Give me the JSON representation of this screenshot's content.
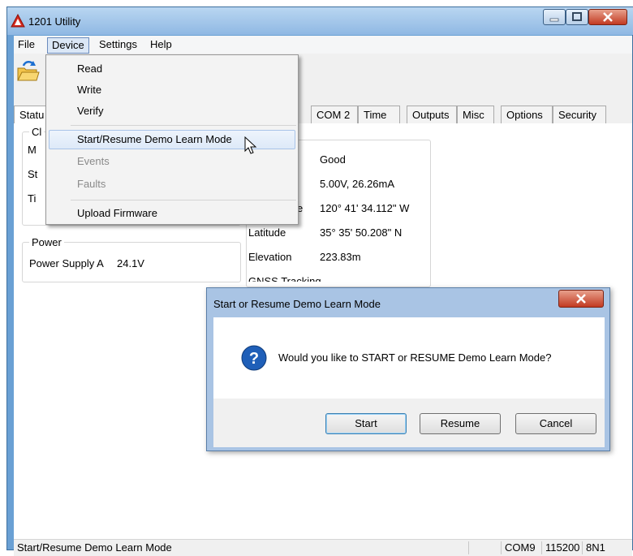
{
  "window": {
    "title": "1201 Utility"
  },
  "menubar": {
    "file": "File",
    "device": "Device",
    "settings": "Settings",
    "help": "Help"
  },
  "tabs": [
    "Statu",
    "COM 2",
    "Time",
    "Outputs",
    "Misc",
    "Options",
    "Security"
  ],
  "clock_group": {
    "label": "Cl",
    "rows": [
      "M",
      "St",
      "Ti"
    ]
  },
  "power_group": {
    "label": "Power",
    "supply_label": "Power Supply A",
    "supply_value": "24.1V"
  },
  "gnss_panel": {
    "rows": [
      {
        "label": "",
        "value": "Good"
      },
      {
        "label": "",
        "value": "5.00V, 26.26mA"
      },
      {
        "label": "e",
        "value": "120° 41' 34.112\" W"
      },
      {
        "label": "Latitude",
        "value": "35° 35' 50.208\" N"
      },
      {
        "label": "Elevation",
        "value": "223.83m"
      }
    ],
    "partial": "GNSS Tracking"
  },
  "device_menu": {
    "read": "Read",
    "write": "Write",
    "verify": "Verify",
    "start_demo": "Start/Resume Demo Learn Mode",
    "events": "Events",
    "faults": "Faults",
    "upload": "Upload Firmware"
  },
  "dialog": {
    "title": "Start or Resume Demo Learn Mode",
    "message": "Would you like to START or RESUME Demo Learn Mode?",
    "start": "Start",
    "resume": "Resume",
    "cancel": "Cancel"
  },
  "statusbar": {
    "text": "Start/Resume Demo Learn Mode",
    "port": "COM9",
    "baud": "115200",
    "format": "8N1"
  },
  "colors": {
    "title_bar": "#9ec3eb",
    "highlight": "#dde9f8",
    "question_icon": "#1f5fb8"
  }
}
